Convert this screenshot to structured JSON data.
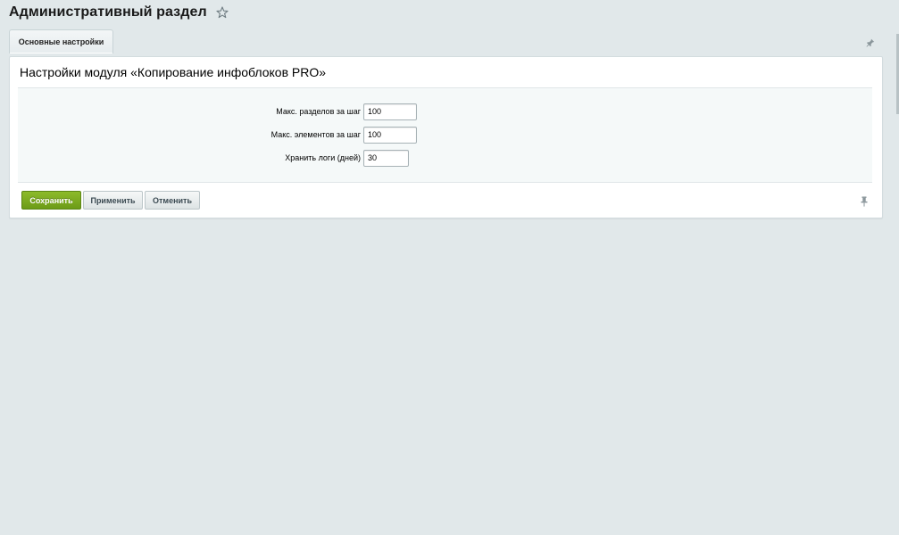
{
  "header": {
    "title": "Административный раздел",
    "favorite_icon": "star-outline-icon"
  },
  "tabs": [
    {
      "label": "Основные настройки",
      "active": true
    }
  ],
  "tabs_pin_icon": "pin-icon",
  "panel": {
    "title": "Настройки модуля «Копирование инфоблоков PRO»",
    "fields": [
      {
        "label": "Макс. разделов за шаг",
        "value": "100"
      },
      {
        "label": "Макс. элементов за шаг",
        "value": "100"
      },
      {
        "label": "Хранить логи (дней)",
        "value": "30"
      }
    ]
  },
  "buttons": {
    "save": "Сохранить",
    "apply": "Применить",
    "cancel": "Отменить"
  },
  "footer_pin_icon": "pin-icon",
  "colors": {
    "background": "#e1e8ea",
    "save_button": "#7aa81f",
    "panel": "#ffffff",
    "settings_block": "#f5f9f9"
  }
}
